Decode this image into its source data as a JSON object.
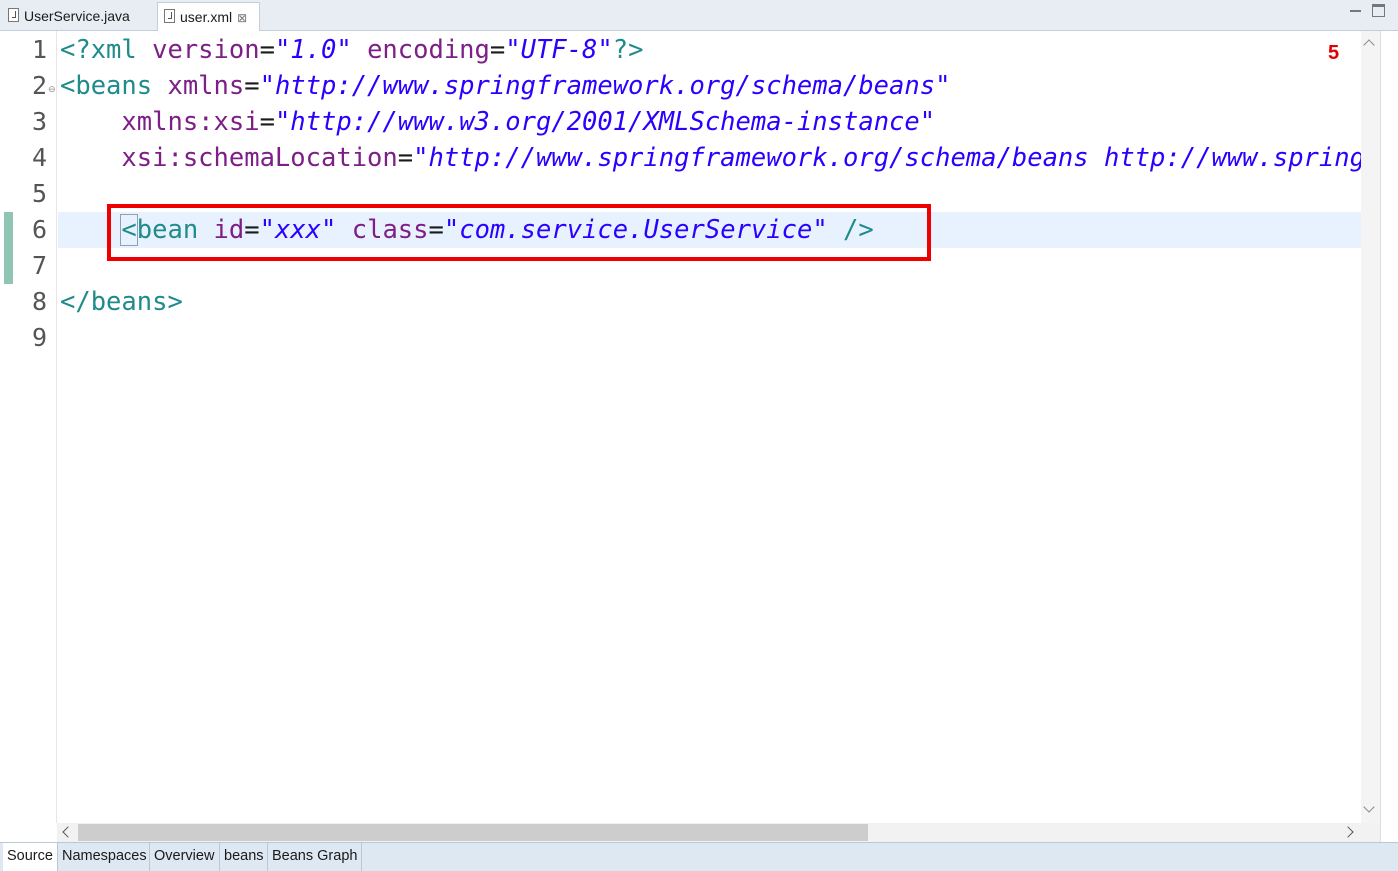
{
  "tabs": [
    {
      "label": "UserService.java",
      "active": false,
      "icon": "java-file-icon"
    },
    {
      "label": "user.xml",
      "active": true,
      "icon": "xml-file-icon",
      "close_glyph": "⊠"
    }
  ],
  "editor": {
    "line_numbers": [
      "1",
      "2",
      "3",
      "4",
      "5",
      "6",
      "7",
      "8",
      "9"
    ],
    "annotation_marker": "5",
    "lines": {
      "l1": {
        "p1": "<?xml ",
        "p2": "version",
        "p3": "=",
        "p4": "\"1.0\"",
        "p5": " encoding",
        "p6": "=",
        "p7": "\"UTF-8\"",
        "p8": "?>"
      },
      "l2": {
        "p1": "<beans ",
        "p2": "xmlns",
        "p3": "=",
        "p4": "\"http://www.springframework.org/schema/beans\""
      },
      "l3": {
        "p1": "    xmlns:xsi",
        "p2": "=",
        "p3": "\"http://www.w3.org/2001/XMLSchema-instance\""
      },
      "l4": {
        "p1": "    xsi:schemaLocation",
        "p2": "=",
        "p3": "\"http://www.springframework.org/schema/beans http://www.springframework.org/schema/beans/spring-beans.xsd\""
      },
      "l6": {
        "indent": "    ",
        "p1": "<",
        "p2": "bean ",
        "p3": "id",
        "p4": "=",
        "p5": "\"xxx\"",
        "p6": " class",
        "p7": "=",
        "p8": "\"com.service.UserService\"",
        "p9": " />"
      },
      "l8": {
        "p1": "</beans>"
      }
    }
  },
  "bottom_tabs": [
    {
      "label": "Source",
      "active": true
    },
    {
      "label": "Namespaces",
      "active": false
    },
    {
      "label": "Overview",
      "active": false
    },
    {
      "label": "beans",
      "active": false
    },
    {
      "label": "Beans Graph",
      "active": false
    }
  ],
  "colors": {
    "tag": "#1f8b8b",
    "attribute": "#7d1f87",
    "value": "#2a00ff",
    "highlight_box": "#ee0000",
    "current_line": "#e8f2fe"
  }
}
